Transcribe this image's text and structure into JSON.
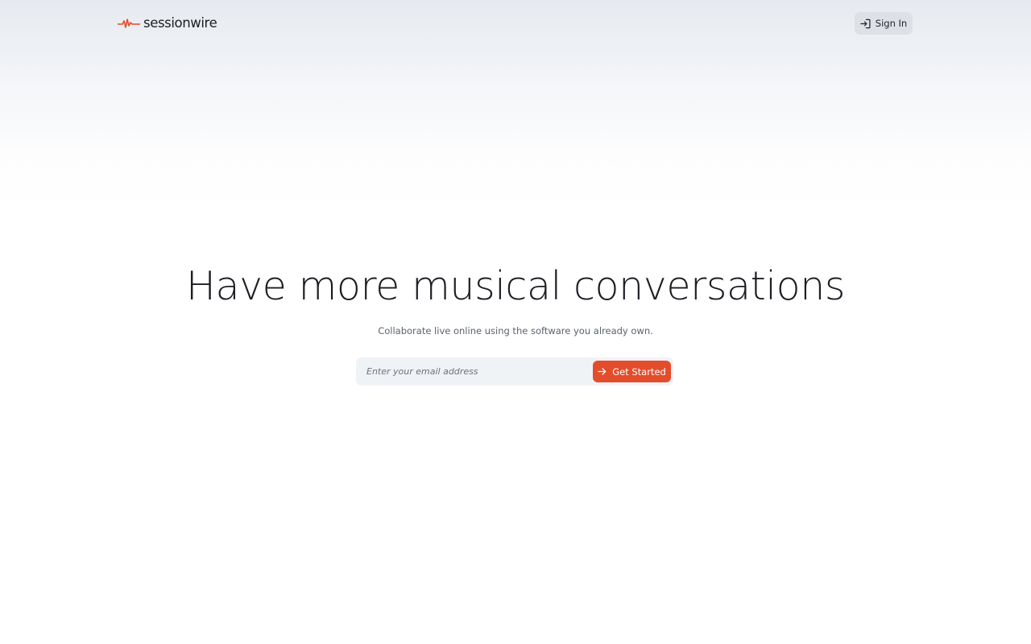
{
  "brand": {
    "name": "sessionwire",
    "accent_color": "#e34d2b",
    "logo_icon": "waveform-icon"
  },
  "header": {
    "signin_label": "Sign In",
    "signin_icon": "sign-in-icon"
  },
  "hero": {
    "title": "Have more musical conversations",
    "subtitle": "Collaborate live online using the software you already own."
  },
  "signup": {
    "email_placeholder": "Enter your email address",
    "email_value": "",
    "button_label": "Get Started",
    "button_icon": "arrow-right-icon"
  }
}
